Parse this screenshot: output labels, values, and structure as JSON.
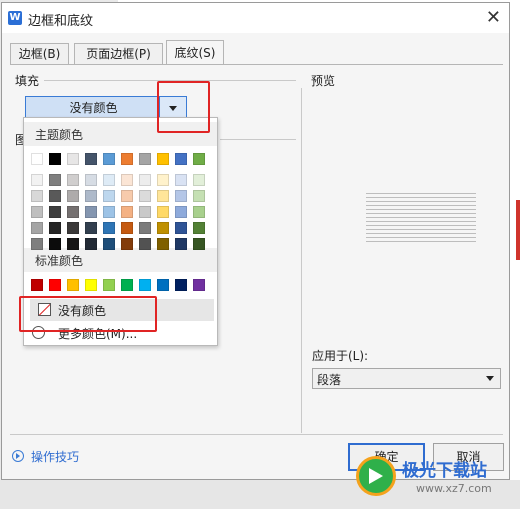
{
  "dialog": {
    "title": "边框和底纹",
    "close_symbol": "✕",
    "app_icon": "W",
    "tabs": [
      {
        "label": "边框(B)",
        "active": false
      },
      {
        "label": "页面边框(P)",
        "active": false
      },
      {
        "label": "底纹(S)",
        "active": true
      }
    ]
  },
  "fill": {
    "group_label": "填充",
    "selected": "没有颜色",
    "pattern_label_partial": "图"
  },
  "color_popup": {
    "theme_heading": "主题颜色",
    "standard_heading": "标准颜色",
    "no_color_label": "没有颜色",
    "more_colors_label": "更多颜色(M)...",
    "theme_colors": [
      [
        "#ffffff",
        "#000000",
        "#e7e6e6",
        "#44546a",
        "#5b9bd5",
        "#ed7d31",
        "#a5a5a5",
        "#ffc000",
        "#4472c4",
        "#70ad47"
      ],
      [
        "#f2f2f2",
        "#7f7f7f",
        "#d0cece",
        "#d6dce4",
        "#deebf6",
        "#fbe5d5",
        "#ededed",
        "#fff2cc",
        "#d9e2f3",
        "#e2efd9"
      ],
      [
        "#d8d8d8",
        "#595959",
        "#aeabab",
        "#adb9ca",
        "#bdd7ee",
        "#f7cbac",
        "#dbdbdb",
        "#ffe599",
        "#b4c6e7",
        "#c5e0b3"
      ],
      [
        "#bfbfbf",
        "#3f3f3f",
        "#757070",
        "#8496b0",
        "#9dc3e6",
        "#f4b183",
        "#c9c9c9",
        "#ffd966",
        "#8eaadb",
        "#a8d08d"
      ],
      [
        "#a5a5a5",
        "#262626",
        "#3a3838",
        "#323f4f",
        "#2e75b5",
        "#c55a11",
        "#7b7b7b",
        "#bf9000",
        "#2f5496",
        "#538135"
      ],
      [
        "#7f7f7f",
        "#0c0c0c",
        "#171616",
        "#222a35",
        "#1e4e79",
        "#833c0b",
        "#525252",
        "#7f6000",
        "#1f3864",
        "#375623"
      ]
    ],
    "standard_colors": [
      "#c00000",
      "#ff0000",
      "#ffc000",
      "#ffff00",
      "#92d050",
      "#00b050",
      "#00b0f0",
      "#0070c0",
      "#002060",
      "#7030a0"
    ]
  },
  "preview": {
    "label": "预览"
  },
  "apply_to": {
    "label": "应用于(L):",
    "value": "段落"
  },
  "footer": {
    "tips_label": "操作技巧",
    "ok_label": "确定",
    "cancel_label": "取消"
  },
  "watermark": {
    "text": "极光下载站",
    "url": "www.xz7.com"
  },
  "icons": [
    "app-icon",
    "close-icon",
    "dropdown-arrow-icon",
    "no-color-icon",
    "palette-icon",
    "play-circle-icon",
    "watermark-logo-icon"
  ]
}
